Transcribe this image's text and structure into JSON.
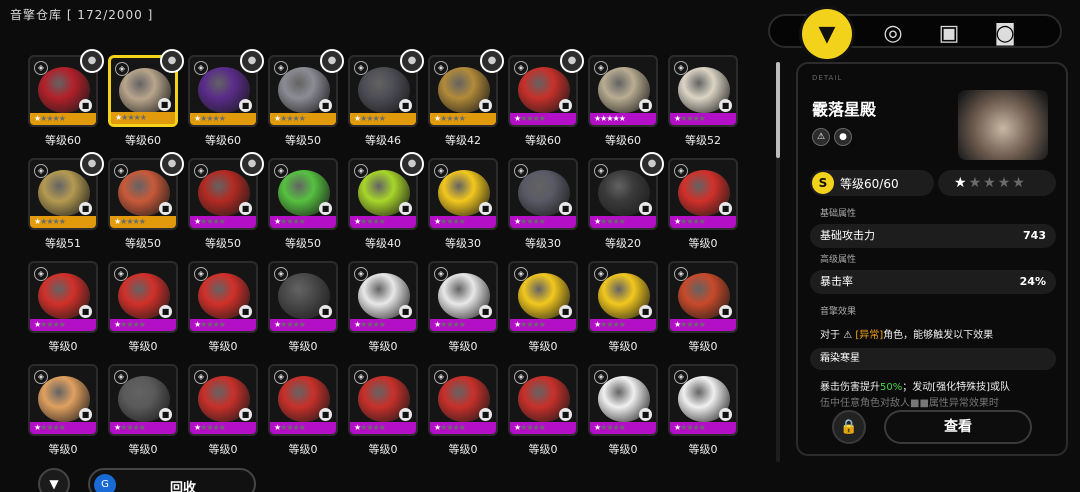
{
  "header": {
    "title": "音擎仓库 [ 172/2000 ]"
  },
  "tabs": [
    {
      "name": "w-engine-tab",
      "icon": "w-engine-icon",
      "glyph": "▼",
      "active": true
    },
    {
      "name": "drive-disc-tab",
      "icon": "disc-icon",
      "glyph": "◎",
      "active": false
    },
    {
      "name": "materials-tab",
      "icon": "box-icon",
      "glyph": "▣",
      "active": false
    },
    {
      "name": "bangboo-tab",
      "icon": "safe-icon",
      "glyph": "◙",
      "active": false
    }
  ],
  "items": [
    {
      "level": "等级60",
      "rarity": "s",
      "stars": 1,
      "avatar": true,
      "color": "#b3202a"
    },
    {
      "level": "等级60",
      "rarity": "s",
      "stars": 1,
      "avatar": true,
      "color": "#b8a58c",
      "selected": true
    },
    {
      "level": "等级60",
      "rarity": "s",
      "stars": 1,
      "avatar": true,
      "color": "#5a2c8a"
    },
    {
      "level": "等级50",
      "rarity": "s",
      "stars": 1,
      "avatar": true,
      "color": "#8c8c95"
    },
    {
      "level": "等级46",
      "rarity": "s",
      "stars": 1,
      "avatar": true,
      "color": "#4d4d55"
    },
    {
      "level": "等级42",
      "rarity": "s",
      "stars": 1,
      "avatar": true,
      "color": "#b28a3a"
    },
    {
      "level": "等级60",
      "rarity": "a",
      "stars": 1,
      "avatar": true,
      "color": "#c8302a"
    },
    {
      "level": "等级60",
      "rarity": "a",
      "stars": 5,
      "avatar": false,
      "color": "#b9ad92"
    },
    {
      "level": "等级52",
      "rarity": "a",
      "stars": 1,
      "avatar": false,
      "color": "#dcd5c5"
    },
    {
      "level": "等级51",
      "rarity": "s",
      "stars": 1,
      "avatar": true,
      "color": "#b49a52"
    },
    {
      "level": "等级50",
      "rarity": "s",
      "stars": 1,
      "avatar": true,
      "color": "#c85a3a"
    },
    {
      "level": "等级50",
      "rarity": "a",
      "stars": 1,
      "avatar": true,
      "color": "#b32a22"
    },
    {
      "level": "等级50",
      "rarity": "a",
      "stars": 1,
      "avatar": false,
      "color": "#56c140"
    },
    {
      "level": "等级40",
      "rarity": "a",
      "stars": 1,
      "avatar": true,
      "color": "#a8d62a"
    },
    {
      "level": "等级30",
      "rarity": "a",
      "stars": 1,
      "avatar": false,
      "color": "#f2c81e"
    },
    {
      "level": "等级30",
      "rarity": "a",
      "stars": 1,
      "avatar": false,
      "color": "#5a5a66"
    },
    {
      "level": "等级20",
      "rarity": "a",
      "stars": 1,
      "avatar": true,
      "color": "#3a3a3a"
    },
    {
      "level": "等级0",
      "rarity": "a",
      "stars": 1,
      "avatar": false,
      "color": "#d2302a"
    },
    {
      "level": "等级0",
      "rarity": "a",
      "stars": 1,
      "avatar": false,
      "color": "#d2302a"
    },
    {
      "level": "等级0",
      "rarity": "a",
      "stars": 1,
      "avatar": false,
      "color": "#d2302a"
    },
    {
      "level": "等级0",
      "rarity": "a",
      "stars": 1,
      "avatar": false,
      "color": "#d2302a"
    },
    {
      "level": "等级0",
      "rarity": "a",
      "stars": 1,
      "avatar": false,
      "color": "#4a4a4a"
    },
    {
      "level": "等级0",
      "rarity": "a",
      "stars": 1,
      "avatar": false,
      "color": "#e8e8e8"
    },
    {
      "level": "等级0",
      "rarity": "a",
      "stars": 1,
      "avatar": false,
      "color": "#e8e8e8"
    },
    {
      "level": "等级0",
      "rarity": "a",
      "stars": 1,
      "avatar": false,
      "color": "#f2c81e"
    },
    {
      "level": "等级0",
      "rarity": "a",
      "stars": 1,
      "avatar": false,
      "color": "#f2c81e"
    },
    {
      "level": "等级0",
      "rarity": "a",
      "stars": 1,
      "avatar": false,
      "color": "#c84a2a"
    },
    {
      "level": "等级0",
      "rarity": "a",
      "stars": 1,
      "avatar": false,
      "color": "#e0a060"
    },
    {
      "level": "等级0",
      "rarity": "a",
      "stars": 1,
      "avatar": false,
      "color": "#5a5a5a"
    },
    {
      "level": "等级0",
      "rarity": "a",
      "stars": 1,
      "avatar": false,
      "color": "#c8302a"
    },
    {
      "level": "等级0",
      "rarity": "a",
      "stars": 1,
      "avatar": false,
      "color": "#c8302a"
    },
    {
      "level": "等级0",
      "rarity": "a",
      "stars": 1,
      "avatar": false,
      "color": "#c8302a"
    },
    {
      "level": "等级0",
      "rarity": "a",
      "stars": 1,
      "avatar": false,
      "color": "#c8302a"
    },
    {
      "level": "等级0",
      "rarity": "a",
      "stars": 1,
      "avatar": false,
      "color": "#c8302a"
    },
    {
      "level": "等级0",
      "rarity": "a",
      "stars": 1,
      "avatar": false,
      "color": "#f0f0f0"
    },
    {
      "level": "等级0",
      "rarity": "a",
      "stars": 1,
      "avatar": false,
      "color": "#f0f0f0"
    }
  ],
  "detail": {
    "label": "DETAIL",
    "name": "霰落星殿",
    "level_text": "等级60/60",
    "level_badge": "S",
    "stars_filled": 1,
    "stars_total": 5,
    "base_section": "基础属性",
    "base_stat_name": "基础攻击力",
    "base_stat_value": "743",
    "adv_section": "高级属性",
    "adv_stat_name": "暴击率",
    "adv_stat_value": "24%",
    "effect_section": "音擎效果",
    "effect_line_prefix": "对于",
    "effect_tag": "[异常]",
    "effect_line_suffix": "角色，能够触发以下效果",
    "effect_title": "霜染寒星",
    "effect_desc_1a": "暴击伤害提升",
    "effect_desc_1b": "50%",
    "effect_desc_1c": "；发动[强化特殊技]或队",
    "effect_desc_2": "伍中任意角色对敌人■■属性异常效果时",
    "view_label": "查看"
  },
  "bottom": {
    "recycle_label": "回收"
  }
}
